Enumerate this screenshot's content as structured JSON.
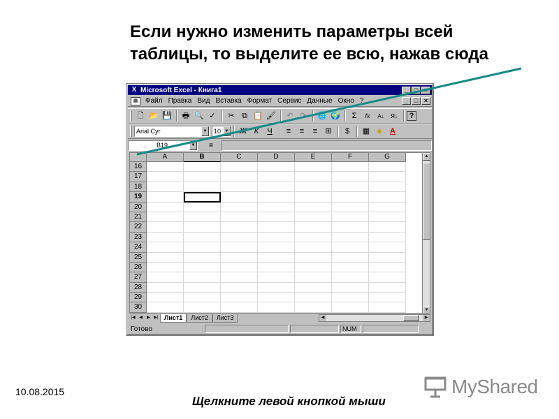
{
  "slide": {
    "title_line1": "Если нужно изменить параметры всей",
    "title_line2": "таблицы, то выделите ее всю, нажав сюда",
    "date": "10.08.2015",
    "caption": "Щелкните левой кнопкой мыши",
    "logo_text": "MyShared",
    "arrow_color": "#178a8a"
  },
  "window": {
    "title": "Microsoft Excel - Книга1",
    "title_buttons": [
      "_",
      "□",
      "×"
    ],
    "menu": [
      "Файл",
      "Правка",
      "Вид",
      "Вставка",
      "Формат",
      "Сервис",
      "Данные",
      "Окно",
      "?"
    ],
    "doc_buttons": [
      "_",
      "□",
      "×"
    ]
  },
  "toolbar_std": {
    "icons": [
      "new-icon",
      "open-icon",
      "save-icon",
      "print-icon",
      "preview-icon",
      "spell-icon",
      "cut-icon",
      "copy-icon",
      "paste-icon",
      "format-painter-icon",
      "undo-icon",
      "redo-icon",
      "hyperlink-icon",
      "web-icon",
      "autosum-icon",
      "function-icon",
      "sort-asc-icon",
      "sort-desc-icon",
      "help-icon"
    ],
    "glyphs": [
      "🗋",
      "📂",
      "💾",
      "🖶",
      "🔍",
      "✓",
      "✂",
      "⧉",
      "📋",
      "🖌",
      "↶",
      "↷",
      "🌐",
      "🌍",
      "Σ",
      "fx",
      "A↓",
      "Я↓",
      "?"
    ]
  },
  "toolbar_fmt": {
    "font_name": "Arial Cyr",
    "font_size": "10",
    "bold": "Ж",
    "italic": "К",
    "underline": "Ч",
    "icons": [
      "align-left-icon",
      "align-center-icon",
      "align-right-icon",
      "merge-center-icon",
      "currency-icon",
      "borders-icon",
      "fill-color-icon",
      "font-color-icon"
    ],
    "glyphs": [
      "≡",
      "≡",
      "≡",
      "⊞",
      "$",
      "▦",
      "◈",
      "A"
    ]
  },
  "formula": {
    "name_box": "B19",
    "eq_label": "="
  },
  "grid": {
    "columns": [
      "A",
      "B",
      "C",
      "D",
      "E",
      "F",
      "G"
    ],
    "active_column": "B",
    "rows": [
      "16",
      "17",
      "18",
      "19",
      "20",
      "21",
      "22",
      "23",
      "24",
      "25",
      "26",
      "27",
      "28",
      "29",
      "30"
    ],
    "active_row": "19"
  },
  "sheets": {
    "tabs": [
      "Лист1",
      "Лист2",
      "Лист3"
    ],
    "active": "Лист1"
  },
  "status": {
    "text": "Готово",
    "num": "NUM"
  }
}
